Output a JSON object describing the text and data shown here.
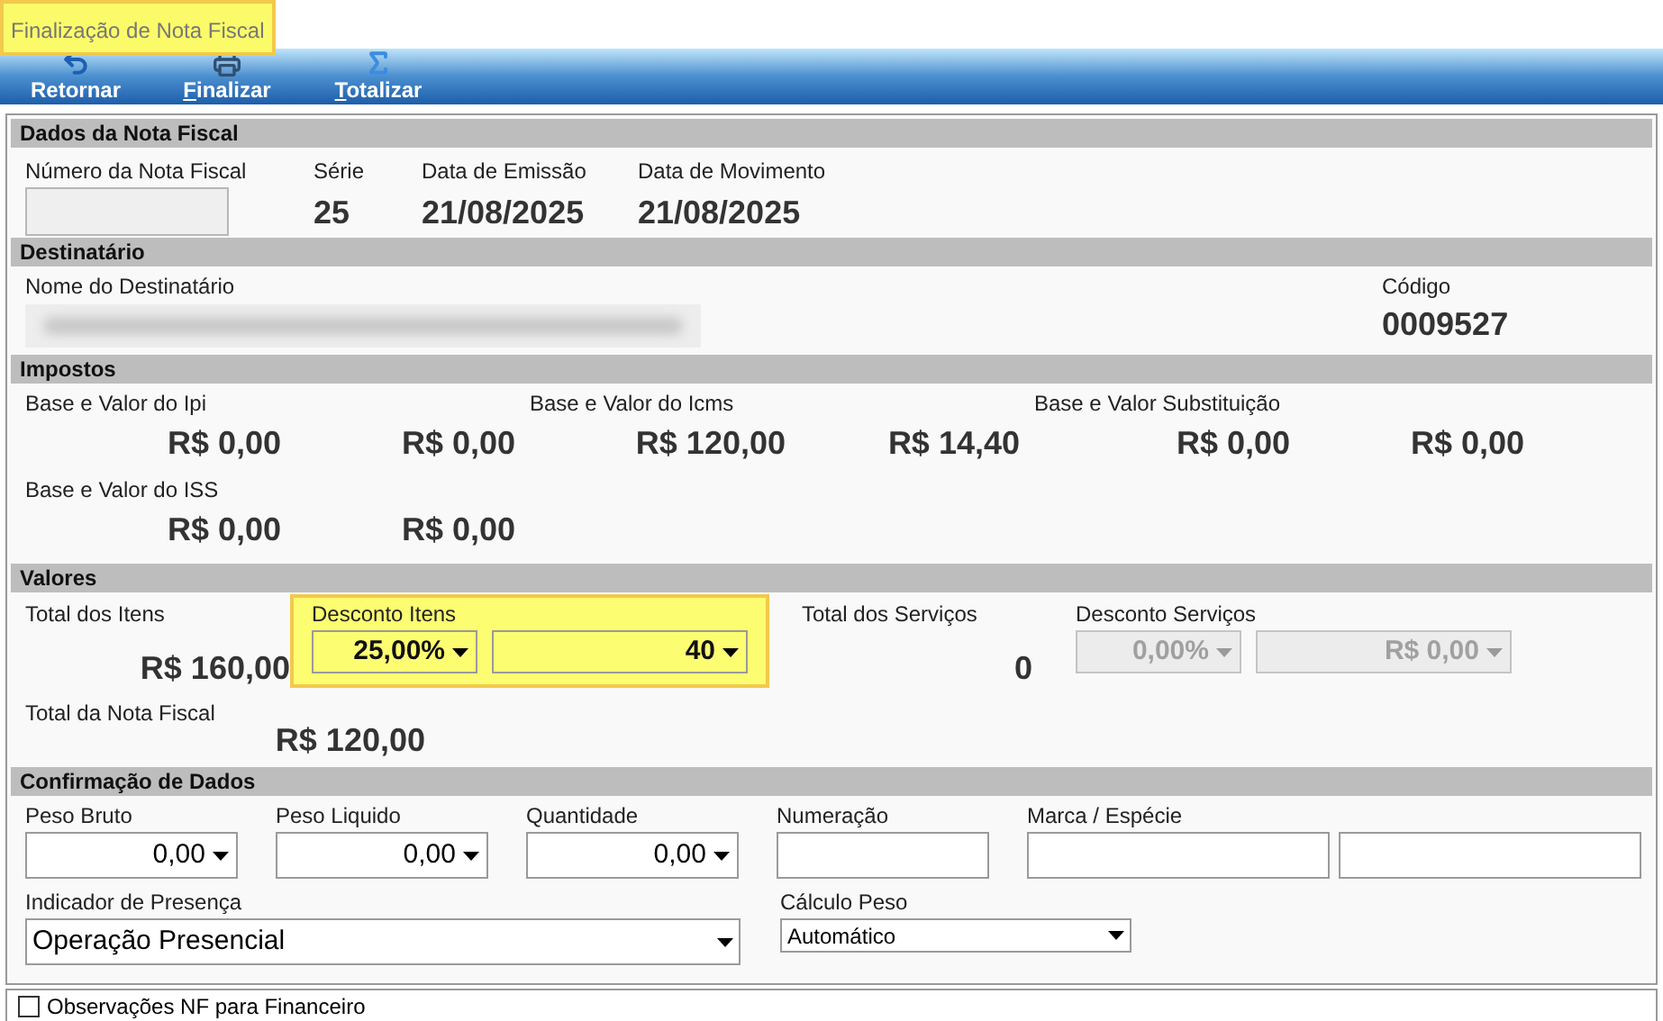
{
  "window": {
    "title": "Finalização de Nota Fiscal",
    "highlighted": true
  },
  "toolbar": [
    {
      "label": "Retornar",
      "kind": "return",
      "underline_first": false
    },
    {
      "label": "Finalizar",
      "kind": "printer",
      "underline_first": true
    },
    {
      "label": "Totalizar",
      "kind": "sigma",
      "underline_first": true
    }
  ],
  "dados_nota": {
    "title": "Dados da Nota Fiscal",
    "fields": [
      {
        "label": "Número da Nota Fiscal",
        "kind": "input"
      },
      {
        "label": "Série",
        "kind": "value",
        "value": "25"
      },
      {
        "label": "Data de Emissão",
        "kind": "value",
        "value": "21/08/2025"
      },
      {
        "label": "Data de Movimento",
        "kind": "value",
        "value": "21/08/2025"
      }
    ]
  },
  "destinatario": {
    "title": "Destinatário",
    "name_label": "Nome do Destinatário",
    "name_redacted": true,
    "code_label": "Código",
    "code": "0009527"
  },
  "impostos": {
    "title": "Impostos",
    "groups": [
      {
        "label": "Base e Valor do Ipi",
        "values": [
          "R$ 0,00",
          "R$ 0,00"
        ]
      },
      {
        "label": "Base e Valor do Icms",
        "values": [
          "R$ 120,00",
          "R$ 14,40"
        ]
      },
      {
        "label": "Base e Valor Substituição",
        "values": [
          "R$ 0,00",
          "R$ 0,00"
        ]
      },
      {
        "label": "Base e Valor do ISS",
        "values": [
          "R$ 0,00",
          "R$ 0,00"
        ]
      }
    ]
  },
  "valores": {
    "title": "Valores",
    "total_itens": {
      "label": "Total dos Itens",
      "value": "R$ 160,00"
    },
    "desconto_itens": {
      "label": "Desconto Itens",
      "highlighted": true,
      "percent": {
        "value": "25,00%",
        "disabled": false
      },
      "amount": {
        "value": "40",
        "disabled": false
      }
    },
    "total_servicos": {
      "label": "Total dos Serviços",
      "value": "0"
    },
    "desconto_servicos": {
      "label": "Desconto Serviços",
      "percent": {
        "value": "0,00%",
        "disabled": true
      },
      "amount": {
        "value": "R$ 0,00",
        "disabled": true
      }
    },
    "total_nota": {
      "label": "Total da Nota Fiscal",
      "value": "R$ 120,00"
    }
  },
  "confirmacao": {
    "title": "Confirmação de Dados",
    "fields": [
      {
        "label": "Peso Bruto",
        "kind": "spin",
        "value": "0,00"
      },
      {
        "label": "Peso Liquido",
        "kind": "spin",
        "value": "0,00"
      },
      {
        "label": "Quantidade",
        "kind": "spin",
        "value": "0,00"
      },
      {
        "label": "Numeração",
        "kind": "text"
      },
      {
        "label": "Marca / Espécie",
        "kind": "text_pair"
      }
    ],
    "indicador": {
      "label": "Indicador de Presença",
      "value": "Operação Presencial"
    },
    "calculo": {
      "label": "Cálculo Peso",
      "value": "Automático"
    }
  },
  "footer_checkbox": {
    "label": "Observações NF para Financeiro",
    "checked": false
  }
}
